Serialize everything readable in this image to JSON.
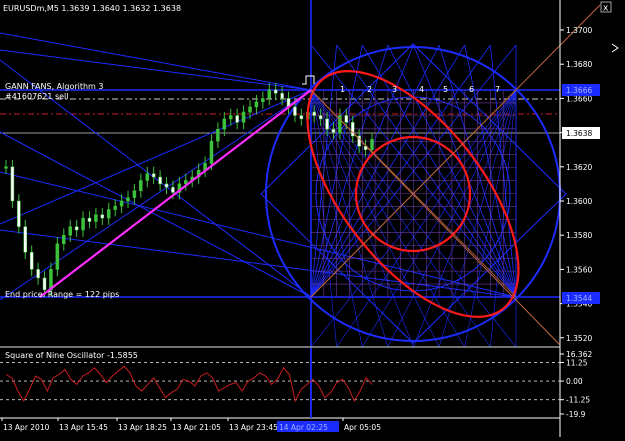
{
  "header": {
    "title": "EURUSDm,M5  1.3639 1.3640 1.3632 1.3638",
    "close_glyph": "x"
  },
  "main_chart": {
    "indicator_label": "GANN FANS, Algorithm 3",
    "order_label": "#41607621 sell",
    "end_price_label": "End price. Range = 122 pips",
    "fan_numbers": [
      "1",
      "2",
      "3",
      "4",
      "5",
      "6",
      "7"
    ],
    "price_axis": {
      "labels": [
        "1.3700",
        "1.3680",
        "1.3660",
        "1.3640",
        "1.3620",
        "1.3600",
        "1.3580",
        "1.3560",
        "1.3540",
        "1.3520"
      ],
      "current_price": "1.3638",
      "highlight_top": "1.3666",
      "highlight_bottom": "1.3544"
    }
  },
  "oscillator": {
    "title": "Square of Nine Oscillator -1.5855",
    "axis_labels": [
      "16.362",
      "11.25",
      "0.00",
      "-11.25",
      "-19.9"
    ]
  },
  "time_axis": {
    "labels": [
      "13 Apr 2010",
      "13 Apr 15:45",
      "13 Apr 18:25",
      "13 Apr 21:05",
      "13 Apr 23:45",
      "Apr 05:05"
    ],
    "highlight_label": "14 Apr 02:25"
  },
  "colors": {
    "background": "#000000",
    "gann_blue": "#1c2cff",
    "grid_purple": "#6a3aa8",
    "ellipse_red": "#ff1a1a",
    "trend_magenta": "#ff2cff",
    "candle_green": "#3cc23c",
    "oscillator_red": "#c81e1e",
    "diag_orange": "#c0663c"
  },
  "chart_data": [
    {
      "type": "line",
      "title": "EURUSDm,M5  1.3639 1.3640 1.3632 1.3638",
      "xlabel": "",
      "ylabel": "",
      "ylim": [
        1.3512,
        1.3712
      ],
      "x_ticks": [
        "13 Apr 2010",
        "13 Apr 15:45",
        "13 Apr 18:25",
        "13 Apr 21:05",
        "13 Apr 23:45",
        "14 Apr 02:25",
        "Apr 05:05"
      ],
      "series": [
        {
          "values": [
            1.362,
            1.36,
            1.3585,
            1.357,
            1.356,
            1.3555,
            1.3548,
            1.356,
            1.3575,
            1.358,
            1.3585,
            1.3583,
            1.359,
            1.3588,
            1.3592,
            1.359,
            1.3595,
            1.3597,
            1.36,
            1.3602,
            1.3606,
            1.3612,
            1.3616,
            1.3614,
            1.361,
            1.3608,
            1.3605,
            1.361,
            1.3612,
            1.3614,
            1.3618,
            1.3622,
            1.3635,
            1.3642,
            1.3648,
            1.365,
            1.3646,
            1.3652,
            1.3655,
            1.3658,
            1.366,
            1.3665,
            1.3663,
            1.366,
            1.3655,
            1.365,
            1.3648,
            1.3652,
            1.365,
            1.3648,
            1.3642,
            1.364,
            1.365,
            1.3646,
            1.3638,
            1.3632,
            1.363,
            1.3636
          ]
        }
      ],
      "annotations": [
        "GANN FANS, Algorithm 3",
        "#41607621 sell",
        "End price. Range = 122 pips",
        "1",
        "2",
        "3",
        "4",
        "5",
        "6",
        "7"
      ]
    },
    {
      "type": "line",
      "title": "Square of Nine Oscillator -1.5855",
      "ylim": [
        -19.9,
        16.362
      ],
      "y_ticks": [
        16.362,
        11.25,
        0.0,
        -11.25,
        -19.9
      ],
      "series": [
        {
          "values": [
            4,
            2,
            -6,
            -12,
            -5,
            3,
            1,
            -6,
            2,
            4,
            7,
            1,
            -2,
            3,
            5,
            8,
            4,
            -1,
            3,
            6,
            9,
            5,
            -3,
            -6,
            -2,
            2,
            -4,
            -10,
            -7,
            -5,
            1,
            0,
            -3,
            3,
            5,
            2,
            -6,
            -4,
            -2,
            -1,
            -6,
            0,
            2,
            5,
            3,
            -2,
            1,
            8,
            4,
            -12,
            -5,
            -2,
            1,
            -3,
            -10,
            -7,
            -1,
            1,
            -4,
            -12,
            -6,
            2,
            -2
          ]
        }
      ]
    }
  ]
}
